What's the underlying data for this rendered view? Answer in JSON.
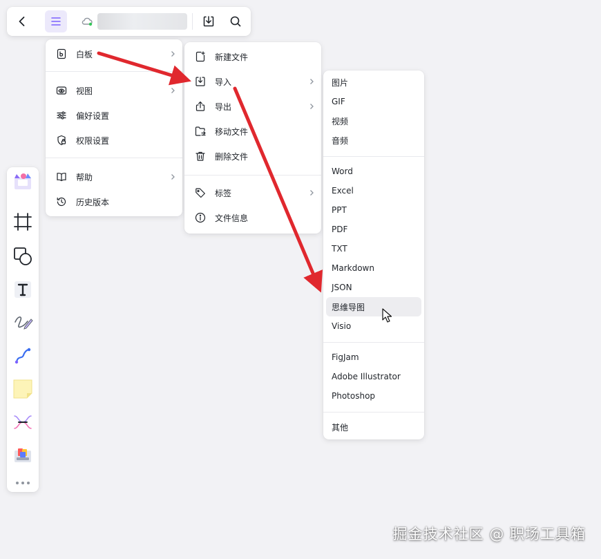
{
  "toolbar": {
    "icons": [
      "back-icon",
      "menu-icon",
      "cloud-sync-icon",
      "download-icon",
      "search-icon"
    ]
  },
  "menu_main": {
    "items": [
      {
        "label": "白板",
        "icon": "whiteboard-icon",
        "submenu": true
      },
      {
        "label": "视图",
        "icon": "eye-icon",
        "submenu": true
      },
      {
        "label": "偏好设置",
        "icon": "sliders-icon",
        "submenu": false
      },
      {
        "label": "权限设置",
        "icon": "lock-shield-icon",
        "submenu": false
      },
      {
        "label": "帮助",
        "icon": "book-icon",
        "submenu": true
      },
      {
        "label": "历史版本",
        "icon": "history-icon",
        "submenu": false
      }
    ]
  },
  "menu_whiteboard": {
    "items": [
      {
        "label": "新建文件",
        "icon": "new-file-icon",
        "submenu": false
      },
      {
        "label": "导入",
        "icon": "import-icon",
        "submenu": true
      },
      {
        "label": "导出",
        "icon": "export-icon",
        "submenu": true
      },
      {
        "label": "移动文件",
        "icon": "move-folder-icon",
        "submenu": false
      },
      {
        "label": "删除文件",
        "icon": "trash-icon",
        "submenu": false
      },
      {
        "label": "标签",
        "icon": "tag-icon",
        "submenu": true
      },
      {
        "label": "文件信息",
        "icon": "info-icon",
        "submenu": false
      }
    ]
  },
  "menu_import": {
    "group1": [
      "图片",
      "GIF",
      "视频",
      "音频"
    ],
    "group2": [
      "Word",
      "Excel",
      "PPT",
      "PDF",
      "TXT",
      "Markdown",
      "JSON",
      "思维导图",
      "Visio"
    ],
    "group3": [
      "FigJam",
      "Adobe Illustrator",
      "Photoshop"
    ],
    "group4": [
      "其他"
    ],
    "hovered": "思维导图"
  },
  "left_toolbar": {
    "tools": [
      "templates-icon",
      "frame-icon",
      "shape-icon",
      "text-icon",
      "pen-icon",
      "connector-icon",
      "sticky-note-icon",
      "mindmap-icon",
      "image-gallery-icon",
      "more-icon"
    ]
  },
  "colors": {
    "accent": "#7b61ff",
    "arrow": "#e0282e",
    "sticky": "#fdf4b8"
  },
  "watermark": "掘金技术社区 @ 职场工具箱"
}
